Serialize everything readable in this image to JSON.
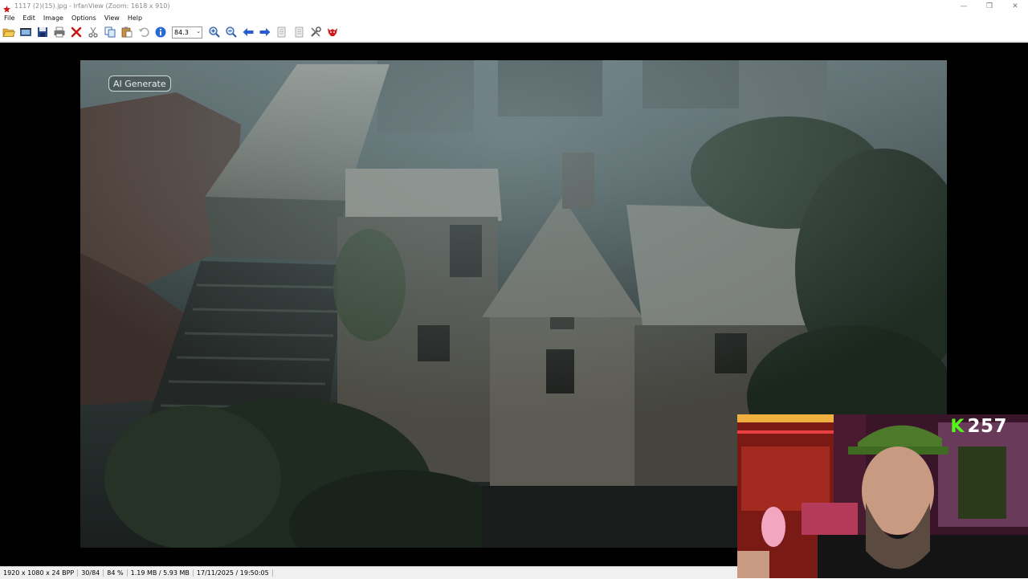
{
  "window": {
    "title": "1117 (2)(15).jpg - IrfanView (Zoom: 1618 x 910)",
    "controls": [
      "—",
      "❐",
      "✕"
    ]
  },
  "menu": [
    "File",
    "Edit",
    "Image",
    "Options",
    "View",
    "Help"
  ],
  "toolbar": {
    "zoom_value": "84.3",
    "icons_left": [
      "open-folder-icon",
      "slideshow-icon",
      "save-icon",
      "print-icon",
      "delete-icon",
      "cut-icon",
      "copy-icon",
      "paste-icon",
      "undo-icon",
      "info-icon"
    ],
    "icons_right": [
      "zoom-in-icon",
      "zoom-out-icon",
      "previous-icon",
      "next-icon",
      "first-page-icon",
      "last-page-icon",
      "settings-icon",
      "irfanview-cat-icon"
    ]
  },
  "image": {
    "overlay_badge": "AI Generate"
  },
  "webcam": {
    "viewer_count": "257"
  },
  "statusbar": {
    "dimensions": "1920 x 1080 x 24 BPP",
    "index": "30/84",
    "zoom": "84 %",
    "filesize": "1.19 MB / 5.93 MB",
    "datetime": "17/11/2025 / 19:50:05"
  },
  "colors": {
    "kick_green": "#53fc18",
    "viewer_bg": "#000000"
  }
}
